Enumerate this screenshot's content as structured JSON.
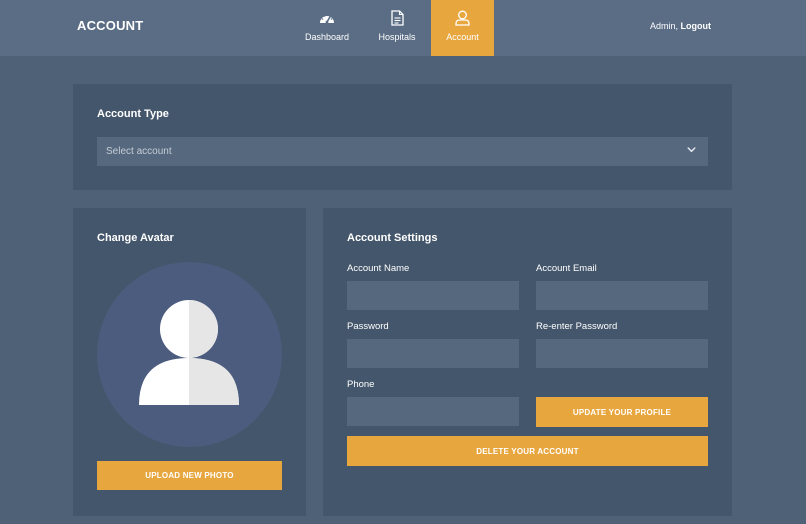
{
  "header": {
    "brand": "ACCOUNT",
    "nav": [
      {
        "label": "Dashboard",
        "icon": "dashboard-gauge-icon"
      },
      {
        "label": "Hospitals",
        "icon": "document-icon"
      },
      {
        "label": "Account",
        "icon": "user-icon",
        "active": true
      }
    ],
    "user_name": "Admin,",
    "logout_label": "Logout"
  },
  "account_type": {
    "title": "Account Type",
    "select_placeholder": "Select account"
  },
  "avatar": {
    "title": "Change Avatar",
    "upload_label": "UPLOAD NEW PHOTO"
  },
  "settings": {
    "title": "Account Settings",
    "account_name_label": "Account Name",
    "account_email_label": "Account Email",
    "password_label": "Password",
    "reenter_password_label": "Re-enter Password",
    "phone_label": "Phone",
    "update_label": "UPDATE YOUR PROFILE",
    "delete_label": "DELETE YOUR ACCOUNT"
  },
  "colors": {
    "background": "#4f6177",
    "topbar": "#5a6d84",
    "panel": "#44566b",
    "field": "#56687e",
    "accent": "#e8a63f",
    "avatar_circle": "#4c5c7e"
  }
}
